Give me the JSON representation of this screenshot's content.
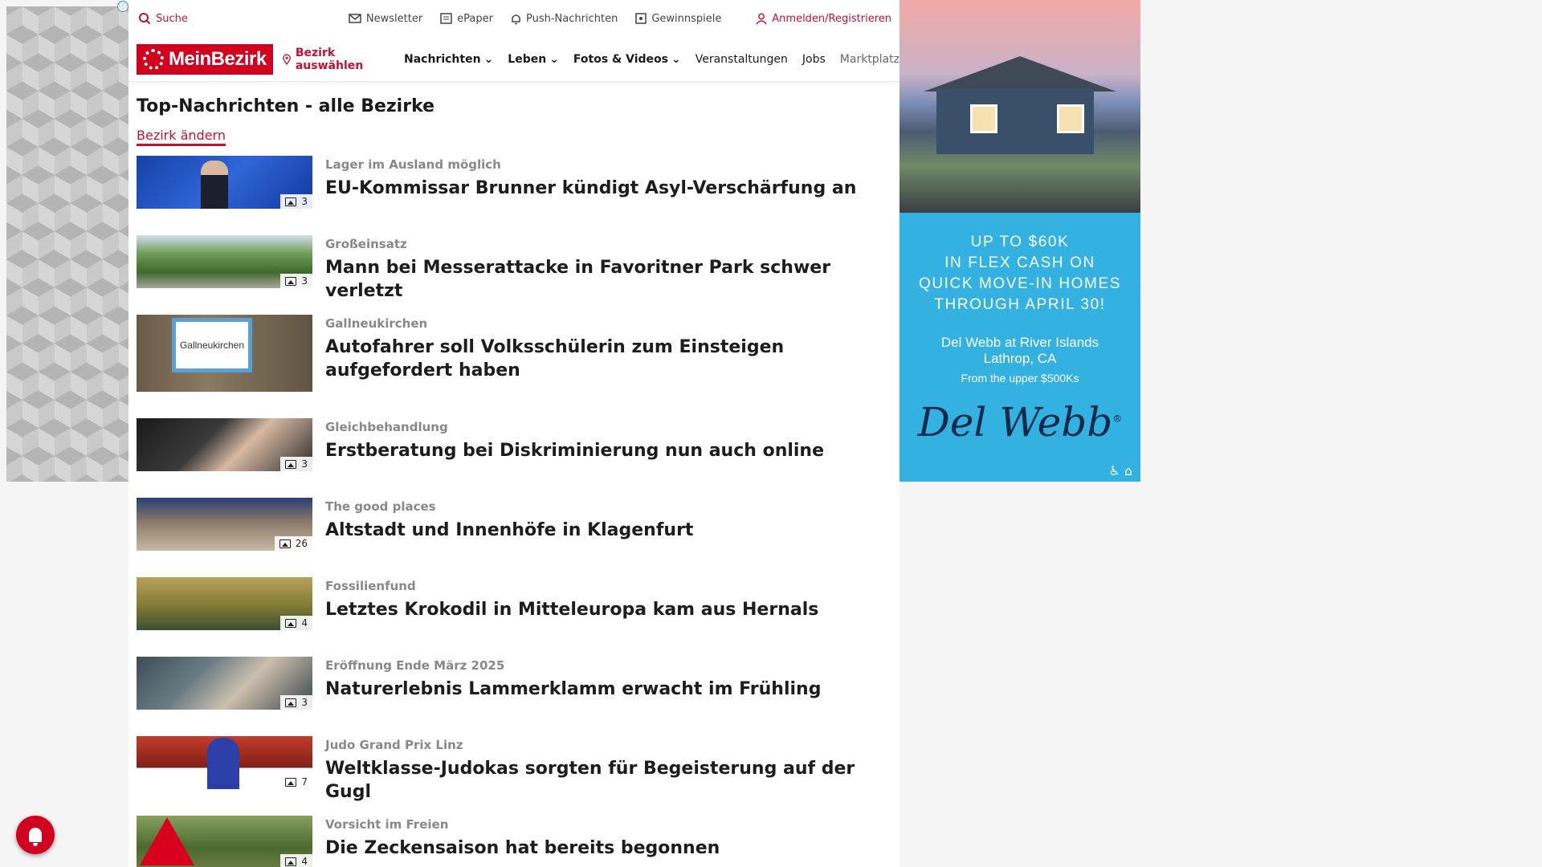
{
  "topbar": {
    "search": "Suche",
    "links": [
      "Newsletter",
      "ePaper",
      "Push-Nachrichten",
      "Gewinnspiele"
    ],
    "login": "Anmelden/Registrieren"
  },
  "navbar": {
    "logo": "MeinBezirk",
    "district": "Bezirk auswählen",
    "items": [
      "Nachrichten",
      "Leben",
      "Fotos & Videos",
      "Veranstaltungen",
      "Jobs",
      "Marktplatz"
    ]
  },
  "main": {
    "heading": "Top-Nachrichten - alle Bezirke",
    "change_district": "Bezirk ändern",
    "articles": [
      {
        "kicker": "Lager im Ausland möglich",
        "title": "EU-Kommissar Brunner kündigt Asyl-Verschärfung an",
        "count": "3"
      },
      {
        "kicker": "Großeinsatz",
        "title": "Mann bei Messerattacke in Favoritner Park schwer verletzt",
        "count": "3"
      },
      {
        "kicker": "Gallneukirchen",
        "title": "Autofahrer soll Volksschülerin zum Einsteigen aufgefordert haben",
        "count": "",
        "sign": "Gallneukirchen"
      },
      {
        "kicker": "Gleichbehandlung",
        "title": "Erstberatung bei Diskriminierung nun auch online",
        "count": "3"
      },
      {
        "kicker": "The good places",
        "title": "Altstadt und Innenhöfe in Klagenfurt",
        "count": "26"
      },
      {
        "kicker": "Fossilienfund",
        "title": "Letztes Krokodil in Mitteleuropa kam aus Hernals",
        "count": "4"
      },
      {
        "kicker": "Eröffnung Ende März 2025",
        "title": "Naturerlebnis Lammerklamm erwacht im Frühling",
        "count": "3"
      },
      {
        "kicker": "Judo Grand Prix Linz",
        "title": "Weltklasse-Judokas sorgten für Begeisterung auf der Gugl",
        "count": "7"
      },
      {
        "kicker": "Vorsicht im Freien",
        "title": "Die Zeckensaison hat bereits begonnen",
        "count": "4"
      }
    ]
  },
  "ad": {
    "headline": [
      "UP TO $60K",
      "IN FLEX CASH ON",
      "QUICK MOVE-IN HOMES",
      "THROUGH APRIL 30!"
    ],
    "community": [
      "Del Webb at River Islands",
      "Lathrop, CA"
    ],
    "price": "From the upper $500Ks",
    "brand": "Del Webb",
    "brand_mark": "®",
    "bottom_icons": "♿ ⌂",
    "colors": {
      "background": "#33b2e2",
      "brand": "#0d2a4a"
    }
  },
  "icons": {
    "info": "ⓘ",
    "adchoices": "▷"
  },
  "colors": {
    "accent": "#c8102e",
    "logo_bg": "#d2001f"
  }
}
